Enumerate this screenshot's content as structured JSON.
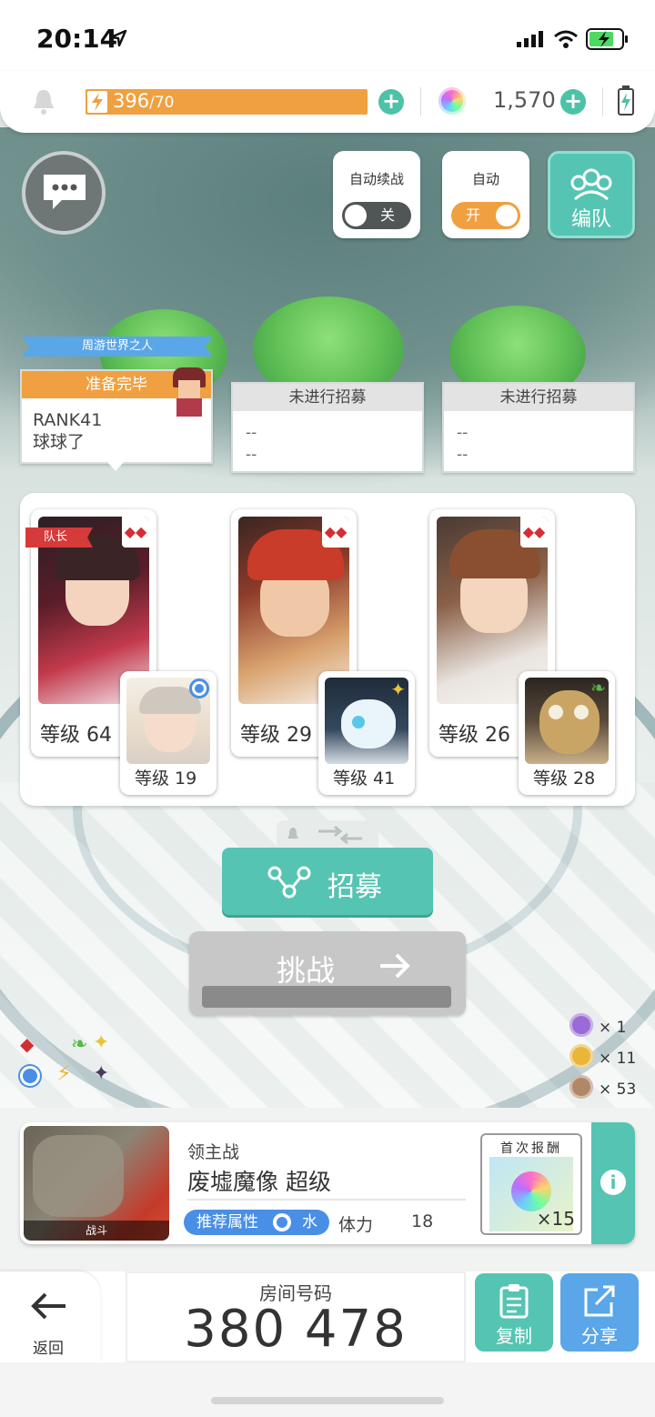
{
  "status_bar": {
    "time": "20:14"
  },
  "top_bar": {
    "stamina": "396",
    "stamina_max": "/70",
    "gems": "1,570"
  },
  "controls": {
    "auto_continue_label": "自动续战",
    "auto_continue_state": "关",
    "auto_label": "自动",
    "auto_state": "开",
    "team_label": "编队"
  },
  "banner": {
    "title": "周游世界之人"
  },
  "slots": [
    {
      "status": "准备完毕",
      "rank": "RANK41",
      "name": "球球了"
    },
    {
      "status": "未进行招募",
      "rank": "--",
      "name": "--"
    },
    {
      "status": "未进行招募",
      "rank": "--",
      "name": "--"
    }
  ],
  "party": {
    "leader_tag": "队长",
    "members": [
      {
        "main_level": "等级 64",
        "sub_level": "等级 19"
      },
      {
        "main_level": "等级 29",
        "sub_level": "等级 41"
      },
      {
        "main_level": "等级 26",
        "sub_level": "等级 28"
      }
    ]
  },
  "actions": {
    "recruit_label": "招募",
    "challenge_label": "挑战"
  },
  "medals": [
    {
      "count": "× 1",
      "color": "#9a6ad6"
    },
    {
      "count": "× 11",
      "color": "#e8b73a"
    },
    {
      "count": "× 53",
      "color": "#b08868"
    }
  ],
  "boss": {
    "category": "领主战",
    "name": "废墟魔像 超级",
    "thumb_label": "战斗",
    "recommend_label": "推荐属性",
    "recommend_element": "水",
    "stamina_label": "体力",
    "stamina_cost": "18",
    "reward_label": "首次报酬",
    "reward_count": "×15"
  },
  "bottom": {
    "back_label": "返回",
    "room_label": "房间号码",
    "room_number": "380 478",
    "copy_label": "复制",
    "share_label": "分享"
  },
  "colors": {
    "accent_teal": "#56c4b2",
    "stamina_orange": "#f0a040",
    "share_blue": "#5aa6e8",
    "recommend_blue": "#4a8fe6"
  }
}
